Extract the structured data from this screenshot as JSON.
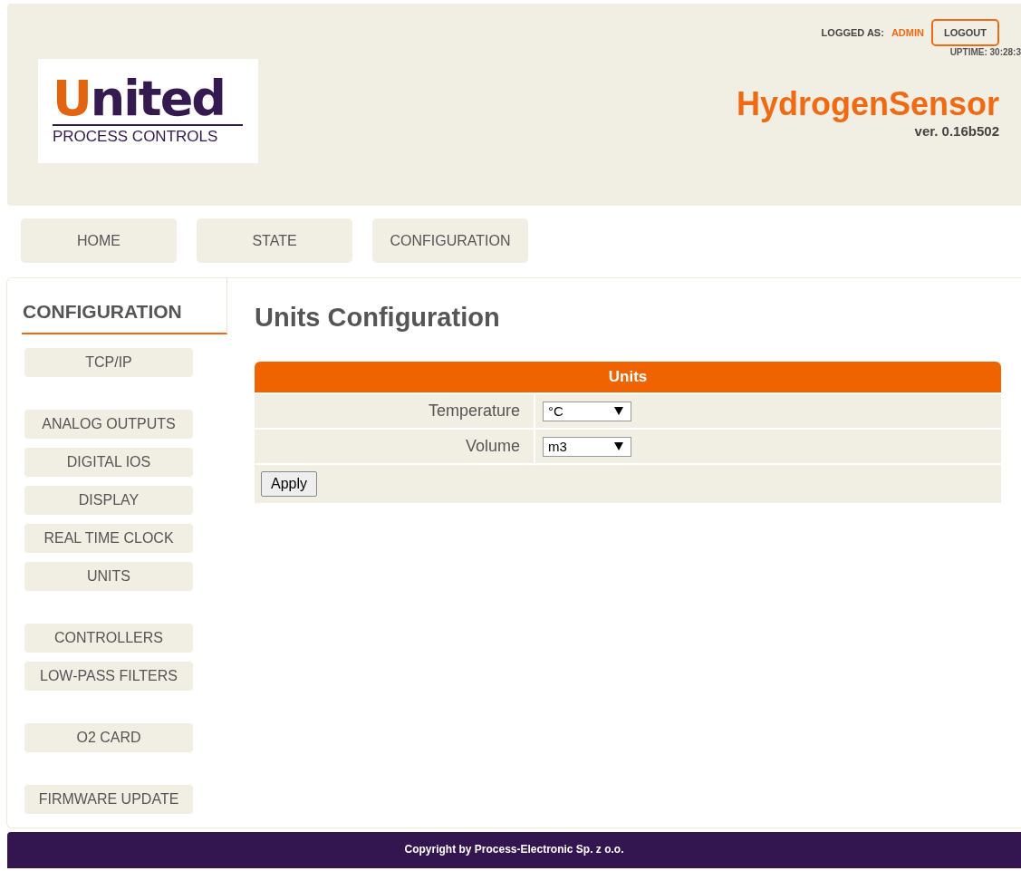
{
  "header": {
    "logo": {
      "word": "United",
      "subtitle": "PROCESS CONTROLS"
    },
    "logged_as_label": "LOGGED AS:",
    "user": "ADMIN",
    "logout": "LOGOUT",
    "uptime": "UPTIME: 30:28:3",
    "product": "HydrogenSensor",
    "version": "ver. 0.16b502"
  },
  "nav": [
    {
      "label": "HOME",
      "selected": false
    },
    {
      "label": "STATE",
      "selected": false
    },
    {
      "label": "CONFIGURATION",
      "selected": false
    }
  ],
  "sidebar": {
    "title": "CONFIGURATION",
    "groups": [
      [
        "TCP/IP"
      ],
      [
        "ANALOG OUTPUTS",
        "DIGITAL IOS",
        "DISPLAY",
        "REAL TIME CLOCK",
        "UNITS"
      ],
      [
        "CONTROLLERS",
        "LOW-PASS FILTERS"
      ],
      [
        "O2 CARD"
      ],
      [
        "FIRMWARE UPDATE"
      ]
    ]
  },
  "content": {
    "title": "Units Configuration",
    "table_title": "Units",
    "rows": [
      {
        "label": "Temperature",
        "value": "°C"
      },
      {
        "label": "Volume",
        "value": "m3"
      }
    ],
    "apply": "Apply"
  },
  "footer": "Copyright by Process-Electronic Sp. z o.o."
}
